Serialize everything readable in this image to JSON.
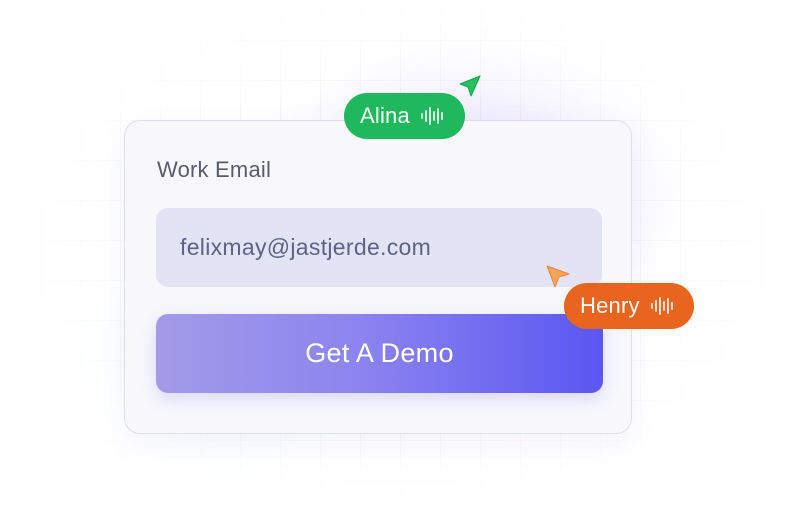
{
  "form": {
    "field_label": "Work Email",
    "email_value": "felixmay@jastjerde.com",
    "button_label": "Get A Demo"
  },
  "collaborators": [
    {
      "name": "Alina",
      "color": "#1fb85c",
      "icon": "audio-wave-icon"
    },
    {
      "name": "Henry",
      "color": "#e9641f",
      "icon": "audio-wave-icon"
    }
  ],
  "colors": {
    "card_background": "#f7f7fc",
    "input_background": "#e2e3f4",
    "button_gradient_start": "#a39be7",
    "button_gradient_end": "#5b57f1"
  }
}
